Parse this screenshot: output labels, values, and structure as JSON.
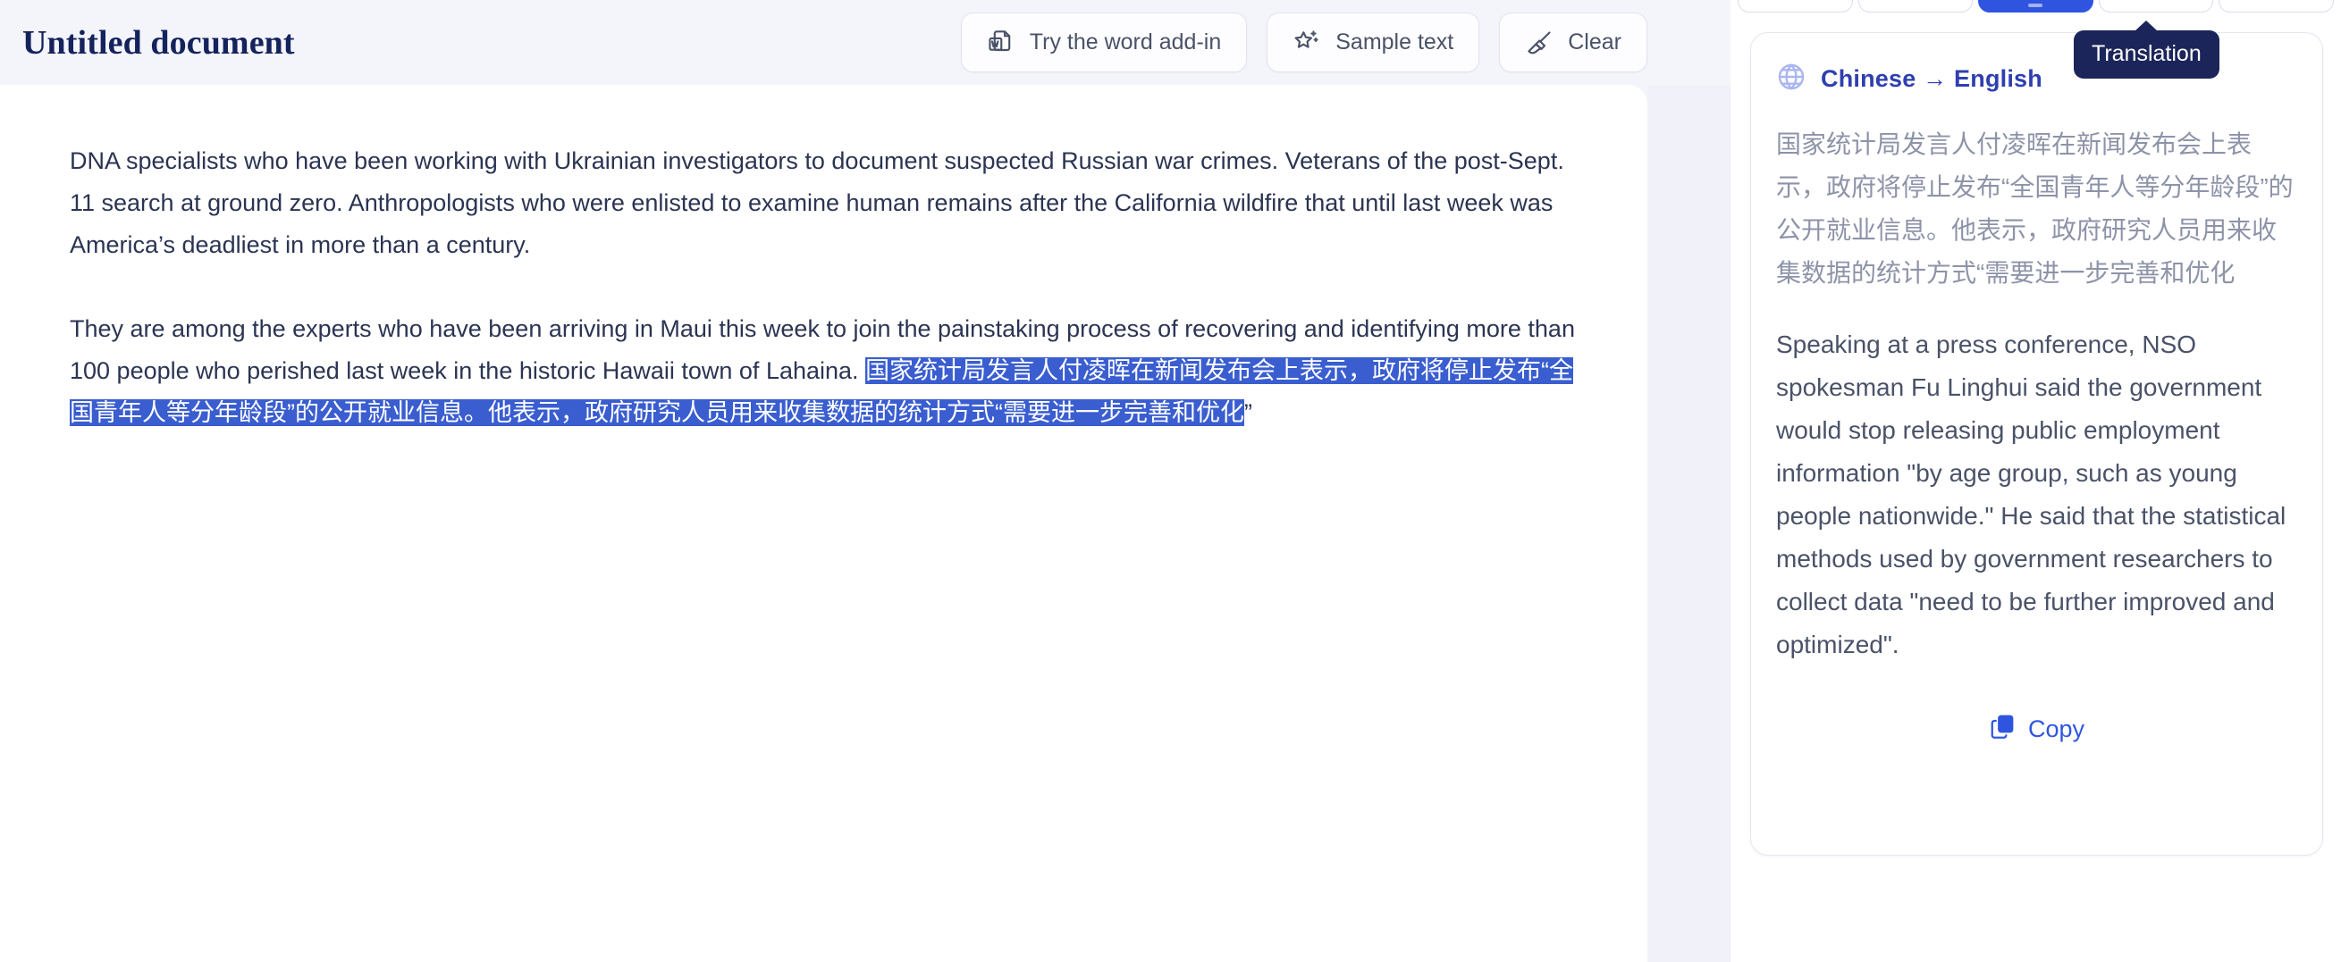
{
  "editor": {
    "title": "Untitled document",
    "toolbar": {
      "word_addin_label": "Try the word add-in",
      "sample_text_label": "Sample text",
      "clear_label": "Clear",
      "word_addin_icon": "word-document-icon",
      "sample_text_icon": "sparkle-star-icon",
      "clear_icon": "broom-icon"
    },
    "paragraphs": {
      "p1": "DNA specialists who have been working with Ukrainian investigators to document suspected Russian war crimes. Veterans of the post-Sept. 11 search at ground zero. Anthropologists who were enlisted to examine human remains after the California wildfire that until last week was America’s deadliest in more than a century.",
      "p2_plain": "They are among the experts who have been arriving in Maui this week to join the painstaking process of recovering and identifying more than 100 people who perished last week in the historic Hawaii town of Lahaina.",
      "p2_selected": "国家统计局发言人付凌晖在新闻发布会上表示，政府将停止发布“全国青年人等分年龄段”的公开就业信息。他表示，政府研究人员用来收集数据的统计方式“需要进一步完善和优化",
      "p2_trailing": "”"
    }
  },
  "panel": {
    "tooltip": "Translation",
    "language_pair": "Chinese → English",
    "globe_icon": "globe-icon",
    "source_text": "国家统计局发言人付凌晖在新闻发布会上表示，政府将停止发布“全国青年人等分年龄段”的公开就业信息。他表示，政府研究人员用来收集数据的统计方式“需要进一步完善和优化",
    "translated_text": "Speaking at a press conference, NSO spokesman Fu Linghui said the government would stop releasing public employment information \"by age group, such as young people nationwide.\" He said that the statistical methods used by government researchers to collect data \"need to be further improved and optimized\".",
    "copy_label": "Copy",
    "copy_icon": "copy-icon",
    "tabs": [
      {
        "label": "",
        "active": false
      },
      {
        "label": "",
        "active": false
      },
      {
        "label": "",
        "active": true
      },
      {
        "label": "",
        "active": false
      },
      {
        "label": "",
        "active": false
      }
    ]
  },
  "colors": {
    "page_bg": "#f4f4fb",
    "accent_blue": "#2f55e0",
    "selection_blue": "#3a5ed0",
    "title_navy": "#14235c",
    "tooltip_navy": "#1b2559",
    "body_text": "#2b3452",
    "muted_text": "#8d93a8"
  }
}
